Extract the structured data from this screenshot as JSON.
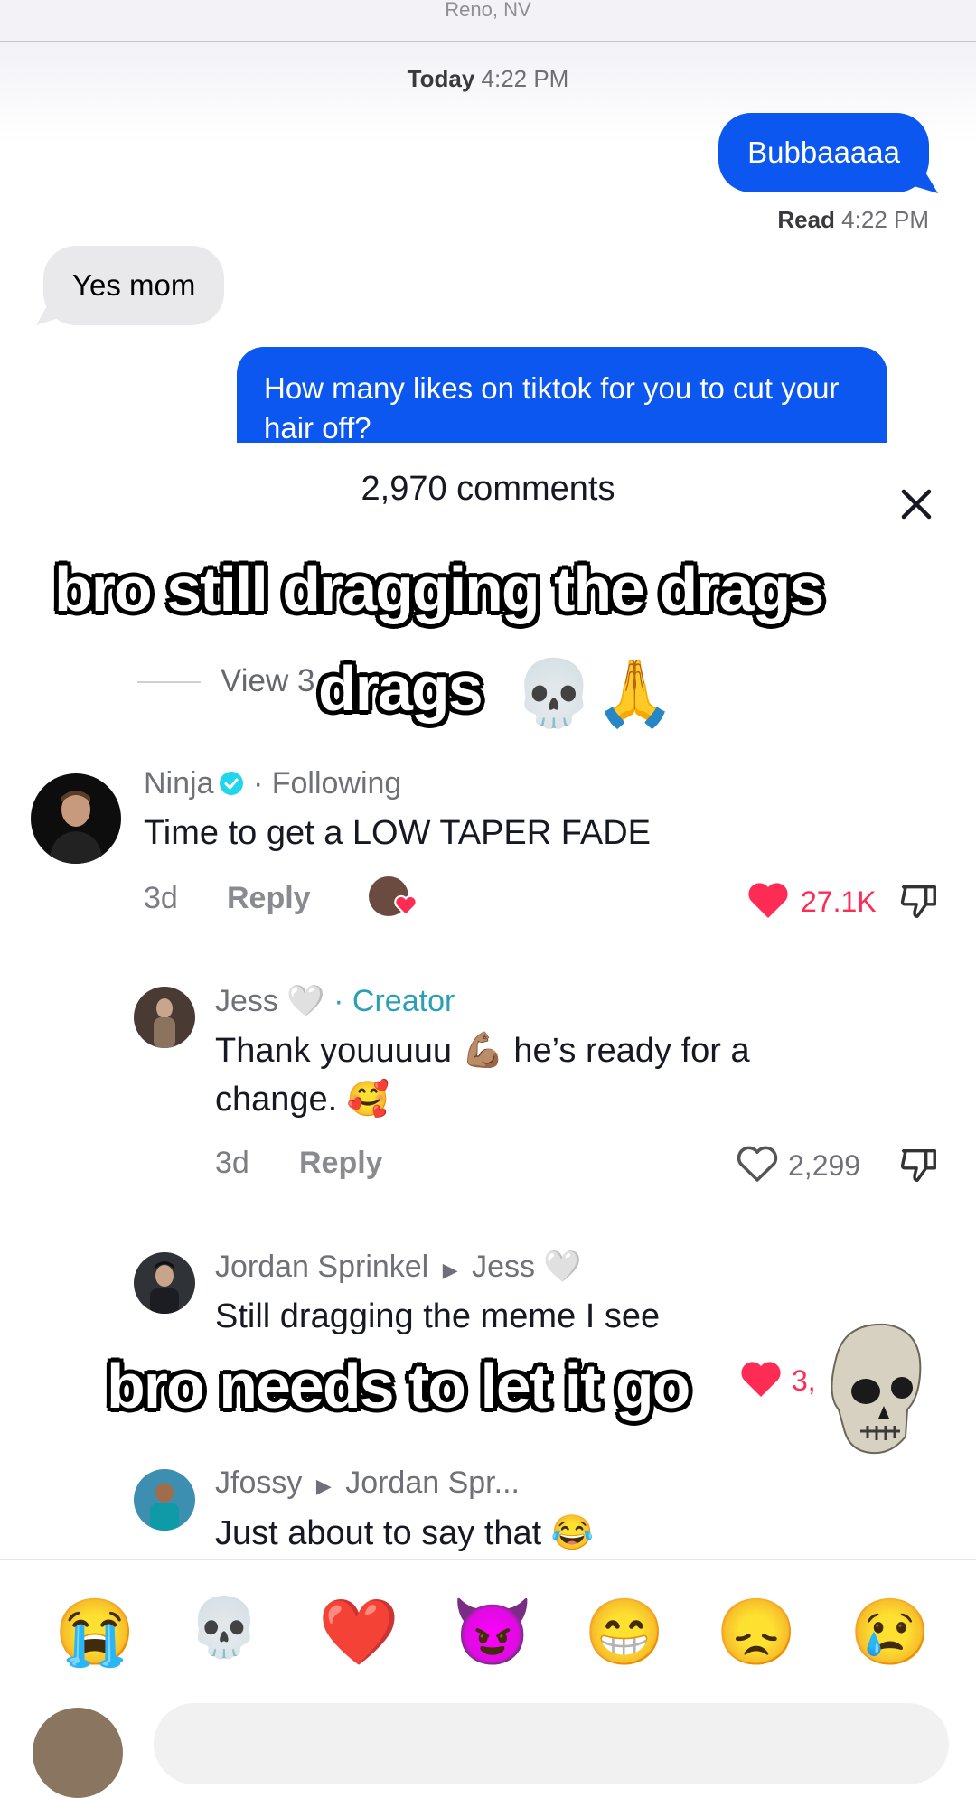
{
  "imessage": {
    "location": "Reno, NV",
    "timestamp_day": "Today",
    "timestamp_time": "4:22 PM",
    "messages": [
      {
        "direction": "out",
        "text": "Bubbaaaaa"
      },
      {
        "direction": "in",
        "text": "Yes mom"
      },
      {
        "direction": "out",
        "text": "How many likes on tiktok for you to cut your hair off?"
      }
    ],
    "read_label": "Read",
    "read_time": "4:22 PM"
  },
  "sheet": {
    "comments_count": "2,970 comments",
    "view_replies": "View 3"
  },
  "captions": {
    "top_line1": "bro still dragging the drags",
    "top_line2": "drags",
    "top_emoji": "💀🙏",
    "bottom": "bro needs to let it go"
  },
  "comments": [
    {
      "name": "Ninja",
      "badge": "· Following",
      "text": "Time to get a LOW TAPER FADE",
      "age": "3d",
      "reply": "Reply",
      "likes": "27.1K",
      "liked": true
    },
    {
      "name": "Jess 🤍",
      "badge": "· Creator",
      "text": "Thank youuuuu 💪🏽  he’s ready for a change. 🥰",
      "age": "3d",
      "reply": "Reply",
      "likes": "2,299",
      "liked": false
    },
    {
      "name": "Jordan Sprinkel",
      "reply_to": "Jess 🤍",
      "text": "Still dragging the meme I see",
      "likes": "3,"
    },
    {
      "name": "Jfossy",
      "reply_to": "Jordan Spr...",
      "text": "Just about to say that 😂"
    }
  ],
  "emoji_bar": [
    "😭",
    "💀",
    "❤️",
    "😈",
    "😁",
    "😞",
    "😢"
  ],
  "colors": {
    "imessage_blue": "#0b57f0",
    "tiktok_red": "#fe2c55",
    "creator_teal": "#2a9fb6"
  }
}
